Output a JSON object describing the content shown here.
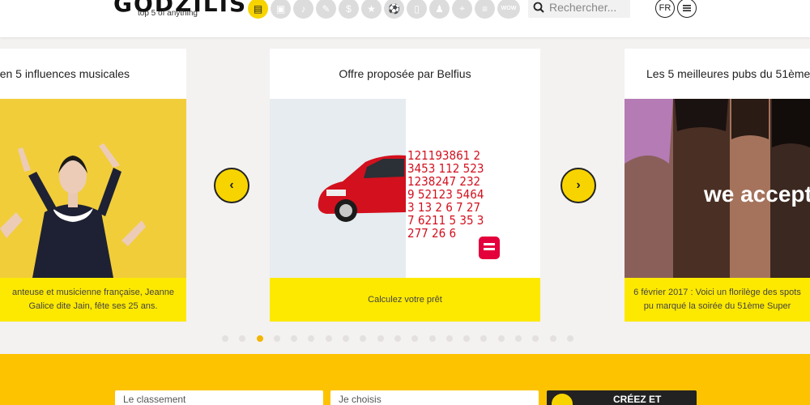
{
  "header": {
    "logo_text": "GODZILIST",
    "tagline": "top 5 of anything",
    "categories": [
      {
        "icon": "news-icon",
        "glyph": "▤"
      },
      {
        "icon": "movie-icon",
        "glyph": "▣"
      },
      {
        "icon": "music-icon",
        "glyph": "♪"
      },
      {
        "icon": "science-icon",
        "glyph": "✎"
      },
      {
        "icon": "money-icon",
        "glyph": "$"
      },
      {
        "icon": "star-icon",
        "glyph": "★"
      },
      {
        "icon": "sport-icon",
        "glyph": "⚽"
      },
      {
        "icon": "tech-icon",
        "glyph": "▯"
      },
      {
        "icon": "fashion-icon",
        "glyph": "♟"
      },
      {
        "icon": "location-icon",
        "glyph": "⌖"
      },
      {
        "icon": "food-icon",
        "glyph": "≡"
      },
      {
        "icon": "wow-icon",
        "glyph": "WOW"
      }
    ],
    "search_placeholder": "Rechercher...",
    "lang": "FR"
  },
  "carousel": {
    "cards": [
      {
        "title": "en 5 influences musicales",
        "caption": "anteuse et musicienne française, Jeanne Galice dite Jain, fête ses 25 ans."
      },
      {
        "title": "Offre proposée par Belfius",
        "caption": "Calculez votre prêt",
        "ad_numbers": "121193861 23453 112 523 1238247 2329 52123 54643 13 2 6 7 27 7 6211 5 35 3 277 26 6"
      },
      {
        "title": "Les 5 meilleures pubs du 51ème",
        "caption": "6 février 2017 : Voici un florilège des spots pu marqué la soirée du 51ème Super",
        "overlay_text": "we accept"
      }
    ],
    "prev_label": "‹",
    "next_label": "›",
    "dot_count": 21,
    "active_dot": 2
  },
  "footer": {
    "field_1": "Le classement",
    "field_2": "Je choisis",
    "create_label": "CRÉEZ ET"
  },
  "colors": {
    "accent": "#f7d400",
    "footer_bg": "#fdc300",
    "caption_bg": "#fde900"
  }
}
